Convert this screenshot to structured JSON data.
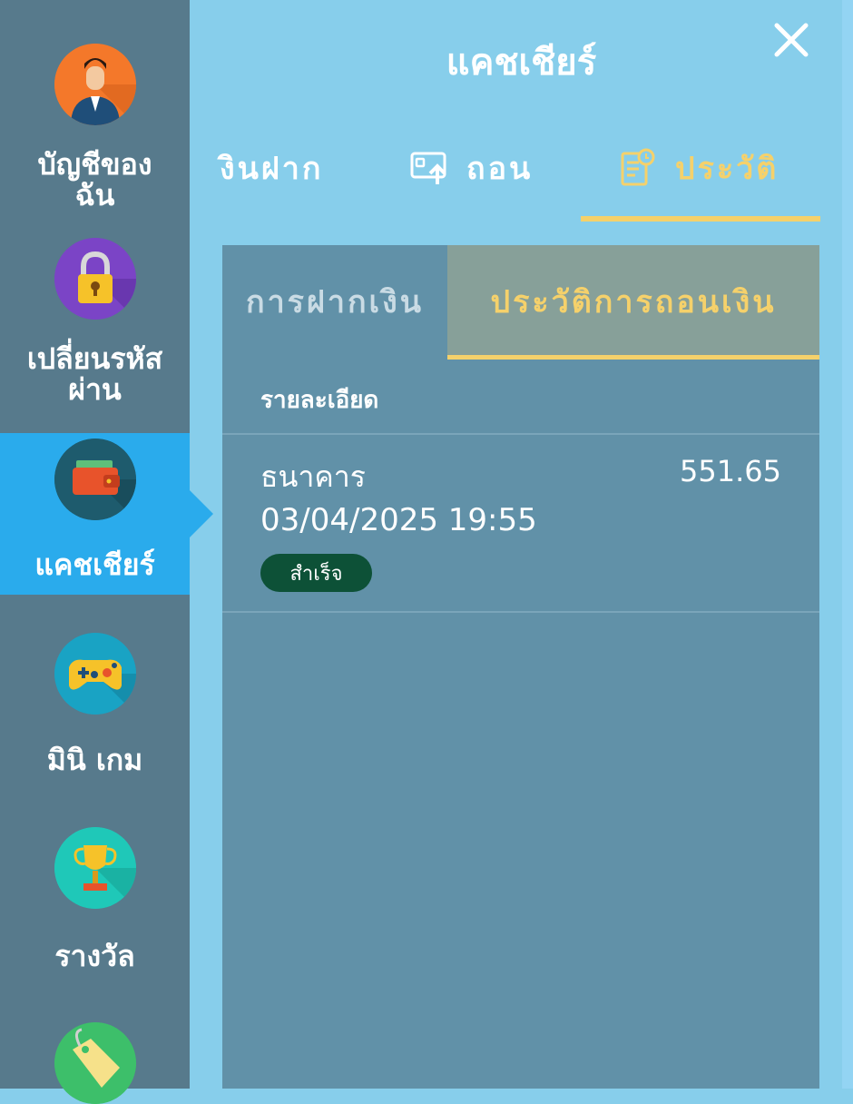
{
  "header": {
    "title": "แคชเชียร์",
    "close_icon": "close-icon"
  },
  "sidebar": {
    "items": [
      {
        "label": "บัญชีของ\nฉัน",
        "icon": "account-avatar-icon",
        "active": false
      },
      {
        "label": "เปลี่ยนรหัส\nผ่าน",
        "icon": "padlock-icon",
        "active": false
      },
      {
        "label": "แคชเชียร์",
        "icon": "wallet-icon",
        "active": true
      },
      {
        "label": "มินิ เกม",
        "icon": "gamepad-icon",
        "active": false
      },
      {
        "label": "รางวัล",
        "icon": "trophy-icon",
        "active": false
      },
      {
        "label": "",
        "icon": "price-tag-icon",
        "active": false
      }
    ],
    "active_color": "#2aabec"
  },
  "tabs": [
    {
      "label": "งินฝาก",
      "icon": "",
      "active": false
    },
    {
      "label": "ถอน",
      "icon": "withdraw-icon",
      "active": false
    },
    {
      "label": "ประวัติ",
      "icon": "history-document-icon",
      "active": true
    }
  ],
  "subtabs": [
    {
      "label": "การฝากเงิน",
      "active": false
    },
    {
      "label": "ประวัติการถอนเงิน",
      "active": true
    }
  ],
  "list": {
    "header": "รายละเอียด",
    "rows": [
      {
        "method": "ธนาคาร",
        "amount": "551.65",
        "datetime": "03/04/2025 19:55",
        "status": "สำเร็จ"
      }
    ]
  },
  "colors": {
    "accent": "#f5d16b",
    "background": "#87CEEB",
    "sidebar": "#577a8c",
    "panel": "#6191a8",
    "success_badge": "#0d5137"
  }
}
